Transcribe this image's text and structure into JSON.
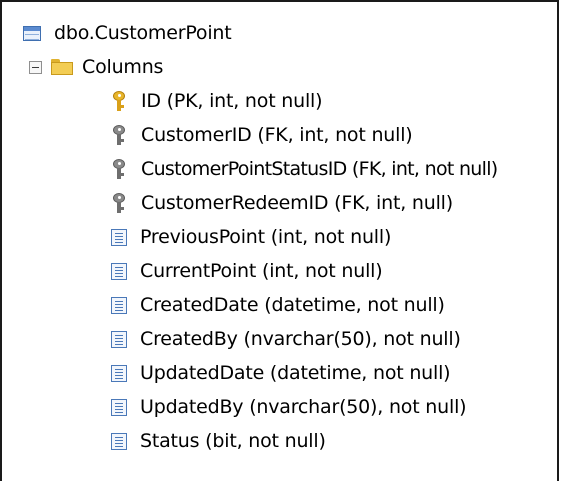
{
  "tree": {
    "table": {
      "label": "dbo.CustomerPoint",
      "icon": "table-icon"
    },
    "folder": {
      "label": "Columns",
      "icon": "folder-icon",
      "expander": "collapse"
    },
    "columns": [
      {
        "label": "ID (PK, int, not null)",
        "icon": "primary-key-icon"
      },
      {
        "label": "CustomerID (FK, int, not null)",
        "icon": "foreign-key-icon"
      },
      {
        "label": "CustomerPointStatusID (FK, int, not null)",
        "icon": "foreign-key-icon"
      },
      {
        "label": "CustomerRedeemID (FK, int, null)",
        "icon": "foreign-key-icon"
      },
      {
        "label": "PreviousPoint (int, not null)",
        "icon": "column-icon"
      },
      {
        "label": "CurrentPoint (int, not null)",
        "icon": "column-icon"
      },
      {
        "label": "CreatedDate (datetime, not null)",
        "icon": "column-icon"
      },
      {
        "label": "CreatedBy (nvarchar(50), not null)",
        "icon": "column-icon"
      },
      {
        "label": "UpdatedDate (datetime, not null)",
        "icon": "column-icon"
      },
      {
        "label": "UpdatedBy (nvarchar(50), not null)",
        "icon": "column-icon"
      },
      {
        "label": "Status (bit, not null)",
        "icon": "column-icon"
      }
    ]
  },
  "colors": {
    "primary_key": "#e8b52a",
    "foreign_key": "#8a8a8a",
    "folder": "#f3cd54",
    "table_icon": "#5b8bd0"
  }
}
